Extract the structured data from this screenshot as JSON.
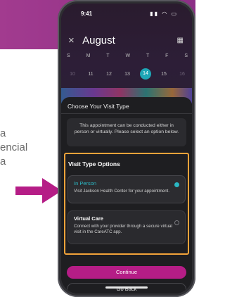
{
  "colors": {
    "brand_magenta": "#b51d86",
    "highlight_orange": "#f2a33a",
    "teal_accent": "#1ea6b6"
  },
  "left_text": {
    "line1": "a",
    "line2": "encial",
    "line3": "a"
  },
  "status_bar": {
    "time": "9:41",
    "icons": "signal wifi battery"
  },
  "calendar": {
    "month": "August",
    "close_glyph": "×",
    "weekdays": [
      "S",
      "M",
      "T",
      "W",
      "T",
      "F",
      "S"
    ],
    "dates": [
      "10",
      "11",
      "12",
      "13",
      "14",
      "15",
      "16"
    ],
    "selected_date": "14"
  },
  "sheet": {
    "title": "Choose Your Visit Type",
    "info": "This appointment can be conducted either in person or virtually. Please select an option below.",
    "options_title": "Visit Type Options",
    "options": [
      {
        "name": "In Person",
        "description": "Visit Jackson Health Center for your appointment.",
        "selected": true
      },
      {
        "name": "Virtual Care",
        "description": "Connect with your provider through a secure virtual visit in the CareATC app.",
        "selected": false
      }
    ],
    "continue_label": "Continue",
    "back_label": "Go Back"
  }
}
